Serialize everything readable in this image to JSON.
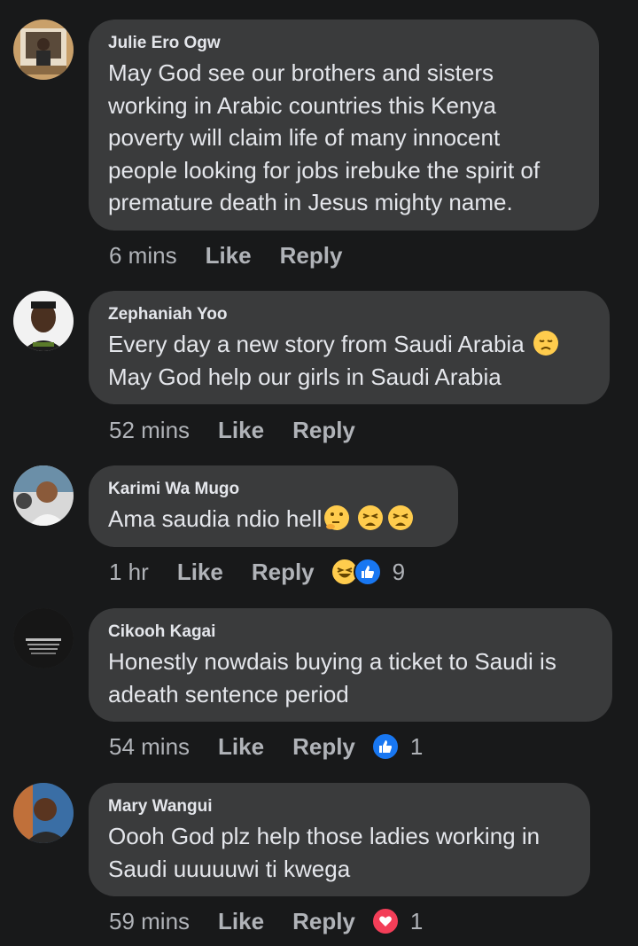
{
  "comments": [
    {
      "author": "Julie Ero Ogw",
      "text": "May God see our brothers and sisters\nworking in Arabic countries this Kenya\npoverty will claim life of many innocent\npeople looking for jobs irebuke the spirit of\npremature death in Jesus mighty name.",
      "time": "6 mins",
      "like_label": "Like",
      "reply_label": "Reply",
      "reaction_count": ""
    },
    {
      "author": "Zephaniah Yoo",
      "text_line1": "Every day a new story from Saudi Arabia",
      "text_line2": "May God help our girls in Saudi Arabia",
      "time": "52 mins",
      "like_label": "Like",
      "reply_label": "Reply",
      "reaction_count": ""
    },
    {
      "author": "Karimi Wa Mugo",
      "text": "Ama saudia ndio hell",
      "time": "1 hr",
      "like_label": "Like",
      "reply_label": "Reply",
      "reaction_count": "9"
    },
    {
      "author": "Cikooh Kagai",
      "text": "Honestly nowdais buying a ticket to Saudi is\nadeath sentence period",
      "time": "54 mins",
      "like_label": "Like",
      "reply_label": "Reply",
      "reaction_count": "1"
    },
    {
      "author": "Mary Wangui",
      "text": "Oooh God plz help those ladies working in\nSaudi uuuuuwi ti kwega",
      "time": "59 mins",
      "like_label": "Like",
      "reply_label": "Reply",
      "reaction_count": "1"
    }
  ],
  "colors": {
    "background": "#18191a",
    "bubble": "#3a3b3c",
    "text_primary": "#e4e6eb",
    "text_secondary": "#b0b3b8",
    "like_blue": "#1877f2",
    "love_red": "#f33e58",
    "emoji_yellow": "#ffcc4d"
  },
  "icons": [
    "sad-emoji-icon",
    "thinking-emoji-icon",
    "weary-emoji-icon",
    "laughing-emoji-icon",
    "like-reaction-icon",
    "love-reaction-icon"
  ]
}
